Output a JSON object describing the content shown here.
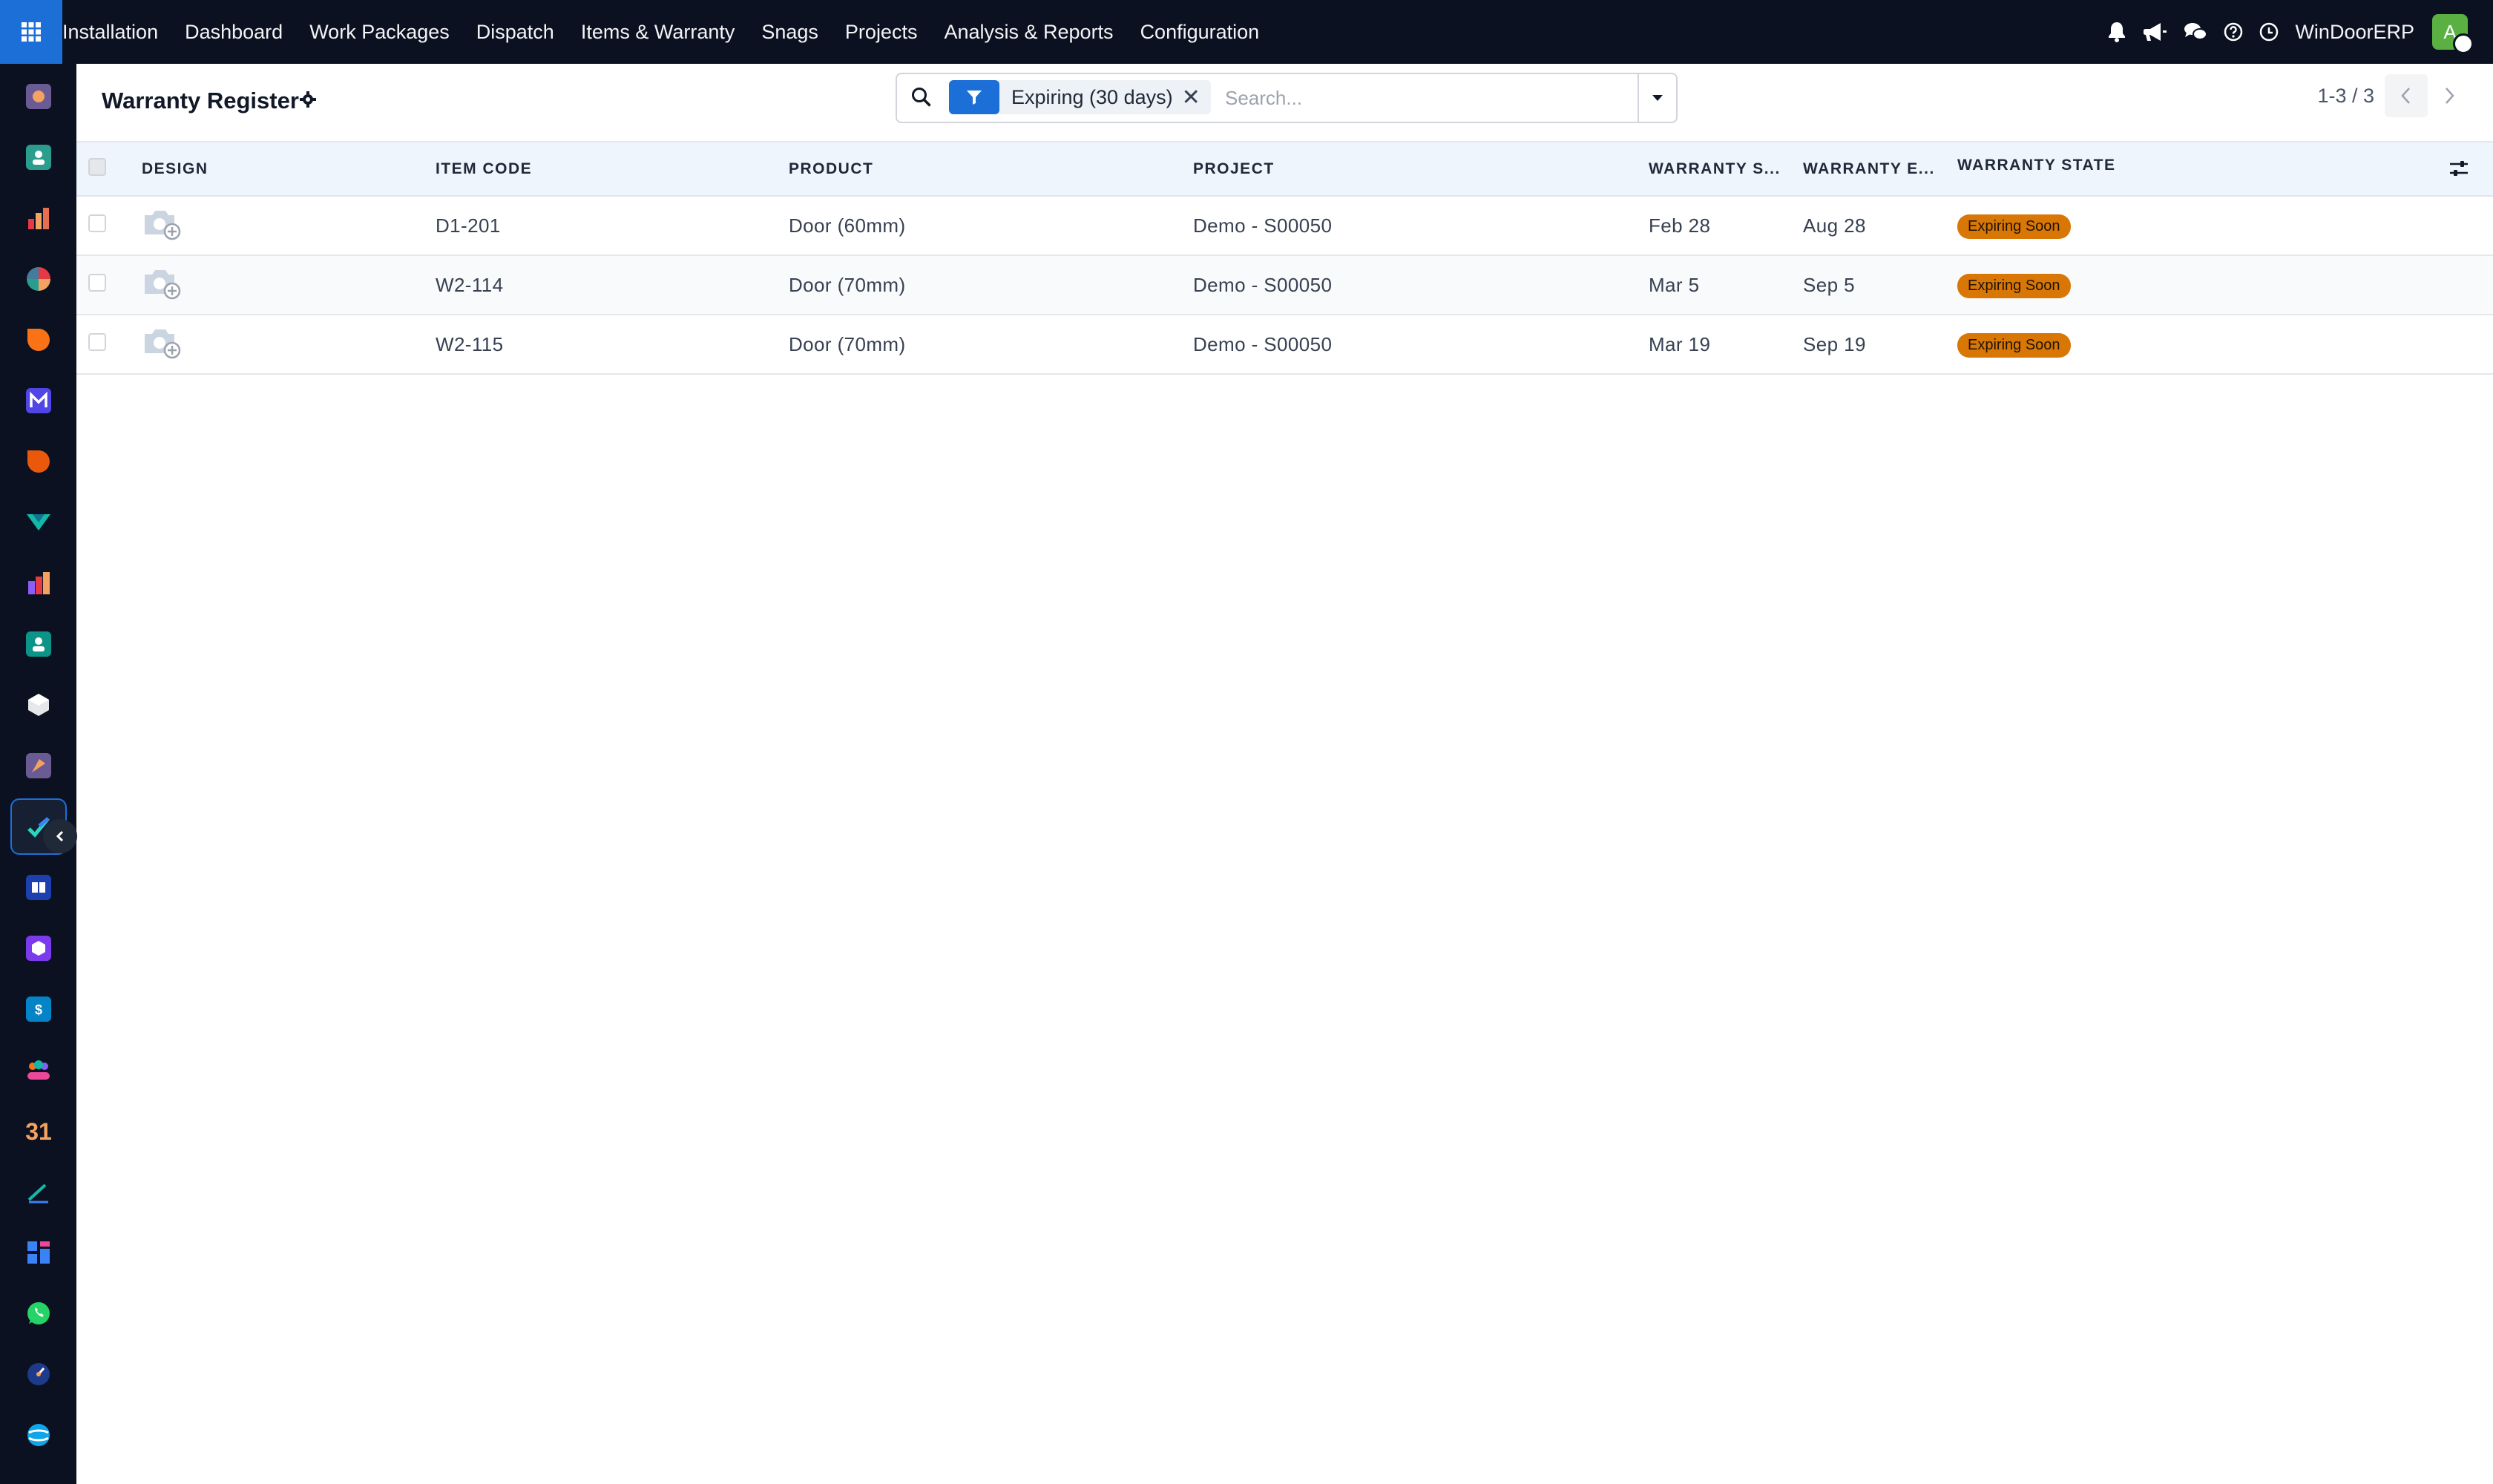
{
  "topbar": {
    "menu": [
      "Installation",
      "Dashboard",
      "Work Packages",
      "Dispatch",
      "Items & Warranty",
      "Snags",
      "Projects",
      "Analysis & Reports",
      "Configuration"
    ],
    "company": "WinDoorERP",
    "avatar_initial": "A",
    "icons": [
      "bell-icon",
      "megaphone-icon",
      "chat-icon",
      "help-icon",
      "clock-icon"
    ]
  },
  "rail": {
    "items": [
      "app-1",
      "app-2",
      "app-3",
      "app-4",
      "app-5",
      "app-6",
      "app-7",
      "app-8",
      "app-9",
      "app-10",
      "app-11",
      "app-12",
      "app-13",
      "app-14",
      "app-15",
      "app-16",
      "app-17",
      "app-18",
      "app-19",
      "app-20",
      "app-21",
      "app-22",
      "app-23",
      "app-24"
    ],
    "active": "app-13"
  },
  "control": {
    "title": "Warranty Register",
    "facet_label": "Expiring (30 days)",
    "search_placeholder": "Search...",
    "pager_value": "1-3 / 3"
  },
  "table": {
    "columns": [
      "Design",
      "Item Code",
      "Product",
      "Project",
      "Warranty S...",
      "Warranty E...",
      "Warranty State"
    ],
    "rows": [
      {
        "item_code": "D1-201",
        "product": "Door (60mm)",
        "project": "Demo - S00050",
        "start": "Feb 28",
        "end": "Aug 28",
        "state": "Expiring Soon"
      },
      {
        "item_code": "W2-114",
        "product": "Door (70mm)",
        "project": "Demo - S00050",
        "start": "Mar 5",
        "end": "Sep 5",
        "state": "Expiring Soon"
      },
      {
        "item_code": "W2-115",
        "product": "Door (70mm)",
        "project": "Demo - S00050",
        "start": "Mar 19",
        "end": "Sep 19",
        "state": "Expiring Soon"
      }
    ]
  },
  "colors": {
    "topbar": "#0b1120",
    "accent": "#1d6fd8",
    "badge": "#d97706",
    "header_row": "#eef5fd"
  }
}
